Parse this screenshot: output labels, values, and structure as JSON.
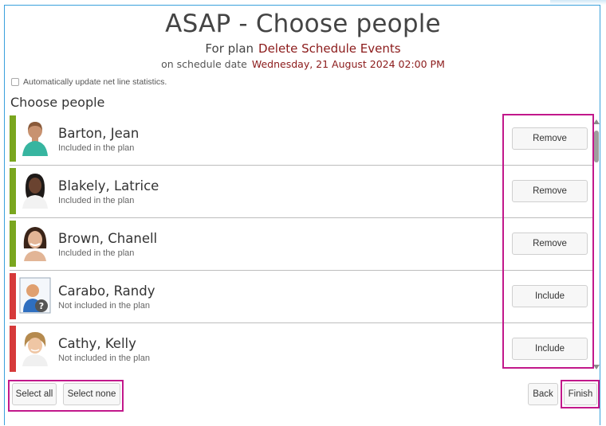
{
  "header": {
    "title": "ASAP - Choose people",
    "plan_prefix": "For plan",
    "plan_name": "Delete Schedule Events",
    "date_prefix": "on schedule date",
    "date_value": "Wednesday, 21 August 2024 02:00 PM"
  },
  "options": {
    "auto_update_label": "Automatically update net line statistics."
  },
  "section": {
    "title": "Choose people"
  },
  "people": [
    {
      "name": "Barton, Jean",
      "status": "Included in the plan",
      "action": "Remove",
      "status_color": "#7aa61f"
    },
    {
      "name": "Blakely, Latrice",
      "status": "Included in the plan",
      "action": "Remove",
      "status_color": "#7aa61f"
    },
    {
      "name": "Brown, Chanell",
      "status": "Included in the plan",
      "action": "Remove",
      "status_color": "#7aa61f"
    },
    {
      "name": "Carabo, Randy",
      "status": "Not included in the plan",
      "action": "Include",
      "status_color": "#d63a3a"
    },
    {
      "name": "Cathy, Kelly",
      "status": "Not included in the plan",
      "action": "Include",
      "status_color": "#d63a3a"
    }
  ],
  "footer": {
    "select_all": "Select all",
    "select_none": "Select none",
    "back": "Back",
    "finish": "Finish"
  },
  "colors": {
    "accent_border": "#3aa0dc",
    "highlight": "#c2188b",
    "included": "#7aa61f",
    "excluded": "#d63a3a"
  }
}
